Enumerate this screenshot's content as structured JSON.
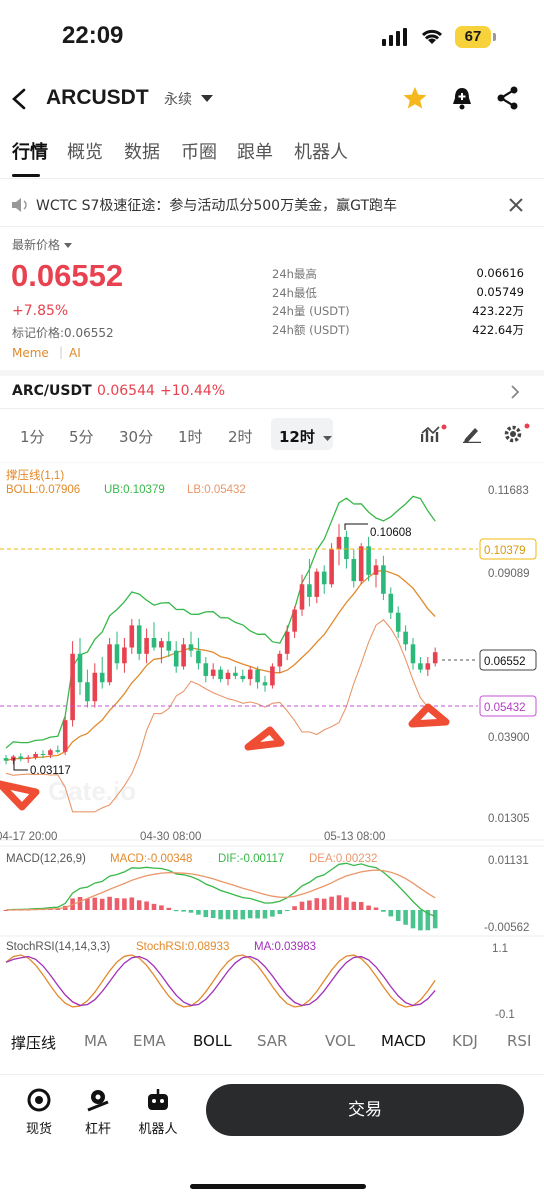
{
  "status": {
    "time": "22:09",
    "battery": "67"
  },
  "header": {
    "symbol": "ARCUSDT",
    "contract_type": "永续"
  },
  "tabs": [
    "行情",
    "概览",
    "数据",
    "币圈",
    "跟单",
    "机器人"
  ],
  "notice": {
    "text": "WCTC S7极速征途：参与活动瓜分500万美金，赢GT跑车"
  },
  "ticker": {
    "price_label": "最新价格",
    "last_price": "0.06552",
    "change": "+7.85%",
    "mark_price": "标记价格:0.06552",
    "tags": [
      "Meme",
      "AI"
    ],
    "stats": [
      {
        "label": "24h最高",
        "value": "0.06616"
      },
      {
        "label": "24h最低",
        "value": "0.05749"
      },
      {
        "label": "24h量 (USDT)",
        "value": "423.22万"
      },
      {
        "label": "24h额 (USDT)",
        "value": "422.64万"
      }
    ]
  },
  "spot_pair": {
    "label": "ARC/USDT",
    "price": "0.06544",
    "change": "+10.44%"
  },
  "intervals": [
    "1分",
    "5分",
    "30分",
    "1时",
    "2时",
    "12时"
  ],
  "selected_interval": "12时",
  "chart_data": {
    "type": "candlestick",
    "indicator_labels": {
      "support": "撑压线(1,1)",
      "boll": "BOLL:0.07906",
      "ub": "UB:0.10379",
      "lb": "LB:0.05432"
    },
    "y_ticks": [
      "0.11683",
      "0.09089",
      "0.03900",
      "0.01305"
    ],
    "x_ticks": [
      "04-17 20:00",
      "04-30 08:00",
      "05-13 08:00"
    ],
    "price_tags": {
      "ub": "0.10379",
      "last": "0.06552",
      "lb": "0.05432"
    },
    "annotations": {
      "high": "0.10608",
      "low": "0.03117"
    },
    "watermark": "Gate.io",
    "macd": {
      "label": "MACD(12,26,9)",
      "macd": "MACD:-0.00348",
      "dif": "DIF:-0.00117",
      "dea": "DEA:0.00232",
      "y_ticks": [
        "0.01131",
        "-0.00562"
      ]
    },
    "stochrsi": {
      "label": "StochRSI(14,14,3,3)",
      "value": "StochRSI:0.08933",
      "ma": "MA:0.03983",
      "y_ticks": [
        "1.1",
        "-0.1"
      ]
    },
    "candles": [
      [
        0.032,
        0.033,
        0.03,
        0.0312
      ],
      [
        0.0312,
        0.033,
        0.03,
        0.0325
      ],
      [
        0.0325,
        0.0335,
        0.031,
        0.0318
      ],
      [
        0.0318,
        0.033,
        0.0305,
        0.0322
      ],
      [
        0.0322,
        0.034,
        0.0315,
        0.0333
      ],
      [
        0.0333,
        0.0345,
        0.032,
        0.033
      ],
      [
        0.033,
        0.035,
        0.032,
        0.0345
      ],
      [
        0.0345,
        0.036,
        0.0335,
        0.034
      ],
      [
        0.034,
        0.045,
        0.033,
        0.044
      ],
      [
        0.044,
        0.069,
        0.042,
        0.065
      ],
      [
        0.065,
        0.07,
        0.052,
        0.056
      ],
      [
        0.056,
        0.06,
        0.048,
        0.05
      ],
      [
        0.05,
        0.062,
        0.048,
        0.059
      ],
      [
        0.059,
        0.064,
        0.054,
        0.056
      ],
      [
        0.056,
        0.07,
        0.055,
        0.068
      ],
      [
        0.068,
        0.072,
        0.06,
        0.062
      ],
      [
        0.062,
        0.07,
        0.059,
        0.067
      ],
      [
        0.067,
        0.076,
        0.065,
        0.074
      ],
      [
        0.074,
        0.076,
        0.063,
        0.065
      ],
      [
        0.065,
        0.073,
        0.062,
        0.07
      ],
      [
        0.07,
        0.075,
        0.066,
        0.067
      ],
      [
        0.067,
        0.07,
        0.062,
        0.069
      ],
      [
        0.069,
        0.072,
        0.064,
        0.066
      ],
      [
        0.066,
        0.069,
        0.059,
        0.061
      ],
      [
        0.061,
        0.07,
        0.06,
        0.068
      ],
      [
        0.068,
        0.072,
        0.064,
        0.066
      ],
      [
        0.066,
        0.07,
        0.06,
        0.062
      ],
      [
        0.062,
        0.064,
        0.056,
        0.058
      ],
      [
        0.058,
        0.062,
        0.057,
        0.06
      ],
      [
        0.06,
        0.061,
        0.056,
        0.057
      ],
      [
        0.057,
        0.06,
        0.055,
        0.059
      ],
      [
        0.059,
        0.061,
        0.057,
        0.058
      ],
      [
        0.058,
        0.06,
        0.056,
        0.057
      ],
      [
        0.057,
        0.061,
        0.055,
        0.06
      ],
      [
        0.06,
        0.061,
        0.054,
        0.056
      ],
      [
        0.056,
        0.058,
        0.053,
        0.055
      ],
      [
        0.055,
        0.062,
        0.054,
        0.061
      ],
      [
        0.061,
        0.066,
        0.059,
        0.065
      ],
      [
        0.065,
        0.074,
        0.063,
        0.072
      ],
      [
        0.072,
        0.08,
        0.07,
        0.079
      ],
      [
        0.079,
        0.09,
        0.077,
        0.087
      ],
      [
        0.087,
        0.095,
        0.08,
        0.083
      ],
      [
        0.083,
        0.092,
        0.081,
        0.091
      ],
      [
        0.091,
        0.093,
        0.084,
        0.087
      ],
      [
        0.087,
        0.1,
        0.086,
        0.098
      ],
      [
        0.098,
        0.1061,
        0.093,
        0.102
      ],
      [
        0.102,
        0.104,
        0.092,
        0.095
      ],
      [
        0.095,
        0.098,
        0.086,
        0.088
      ],
      [
        0.088,
        0.1,
        0.087,
        0.099
      ],
      [
        0.099,
        0.102,
        0.088,
        0.09
      ],
      [
        0.09,
        0.095,
        0.086,
        0.093
      ],
      [
        0.093,
        0.096,
        0.082,
        0.084
      ],
      [
        0.084,
        0.086,
        0.076,
        0.078
      ],
      [
        0.078,
        0.08,
        0.07,
        0.072
      ],
      [
        0.072,
        0.074,
        0.066,
        0.068
      ],
      [
        0.068,
        0.07,
        0.06,
        0.062
      ],
      [
        0.062,
        0.064,
        0.059,
        0.06
      ],
      [
        0.06,
        0.064,
        0.058,
        0.062
      ],
      [
        0.062,
        0.067,
        0.061,
        0.0655
      ]
    ]
  },
  "indicator_tabs": [
    "撑压线",
    "MA",
    "EMA",
    "BOLL",
    "SAR",
    "VOL",
    "MACD",
    "KDJ",
    "RSI"
  ],
  "indicator_tabs_active": [
    "撑压线",
    "BOLL",
    "MACD"
  ],
  "bottom_nav": {
    "spot": "现货",
    "leverage": "杠杆",
    "bot": "机器人",
    "trade": "交易"
  },
  "colors": {
    "up": "#e8414f",
    "down": "#2bb87a",
    "accent": "#f0b90b"
  }
}
